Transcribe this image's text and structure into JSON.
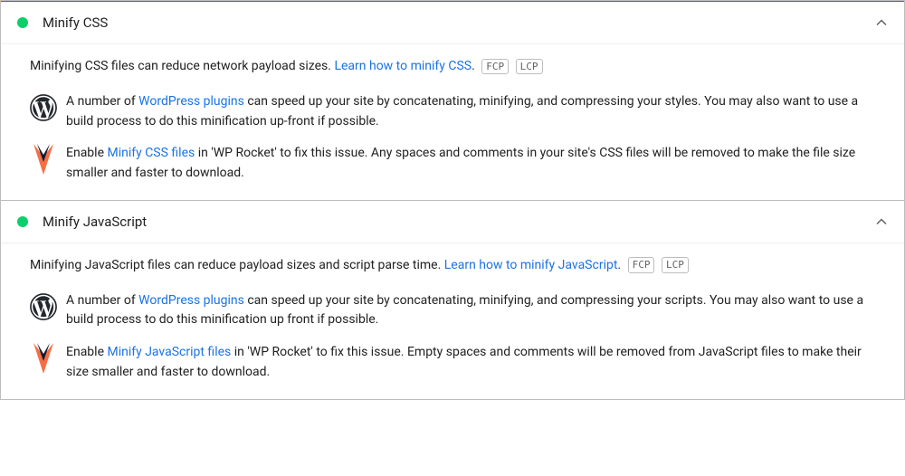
{
  "audits": [
    {
      "title": "Minify CSS",
      "intro_pre": "Minifying CSS files can reduce network payload sizes. ",
      "intro_link": "Learn how to minify CSS",
      "intro_post": ".",
      "badges": [
        "FCP",
        "LCP"
      ],
      "tips": [
        {
          "icon": "wordpress",
          "pre": "A number of ",
          "link": "WordPress plugins",
          "post": " can speed up your site by concatenating, minifying, and compressing your styles. You may also want to use a build process to do this minification up-front if possible."
        },
        {
          "icon": "wprocket",
          "pre": "Enable ",
          "link": "Minify CSS files",
          "post": " in 'WP Rocket' to fix this issue. Any spaces and comments in your site's CSS files will be removed to make the file size smaller and faster to download."
        }
      ]
    },
    {
      "title": "Minify JavaScript",
      "intro_pre": "Minifying JavaScript files can reduce payload sizes and script parse time. ",
      "intro_link": "Learn how to minify JavaScript",
      "intro_post": ".",
      "badges": [
        "FCP",
        "LCP"
      ],
      "tips": [
        {
          "icon": "wordpress",
          "pre": "A number of ",
          "link": "WordPress plugins",
          "post": " can speed up your site by concatenating, minifying, and compressing your scripts. You may also want to use a build process to do this minification up front if possible."
        },
        {
          "icon": "wprocket",
          "pre": "Enable ",
          "link": "Minify JavaScript files",
          "post": " in 'WP Rocket' to fix this issue. Empty spaces and comments will be removed from JavaScript files to make their size smaller and faster to download."
        }
      ]
    }
  ]
}
